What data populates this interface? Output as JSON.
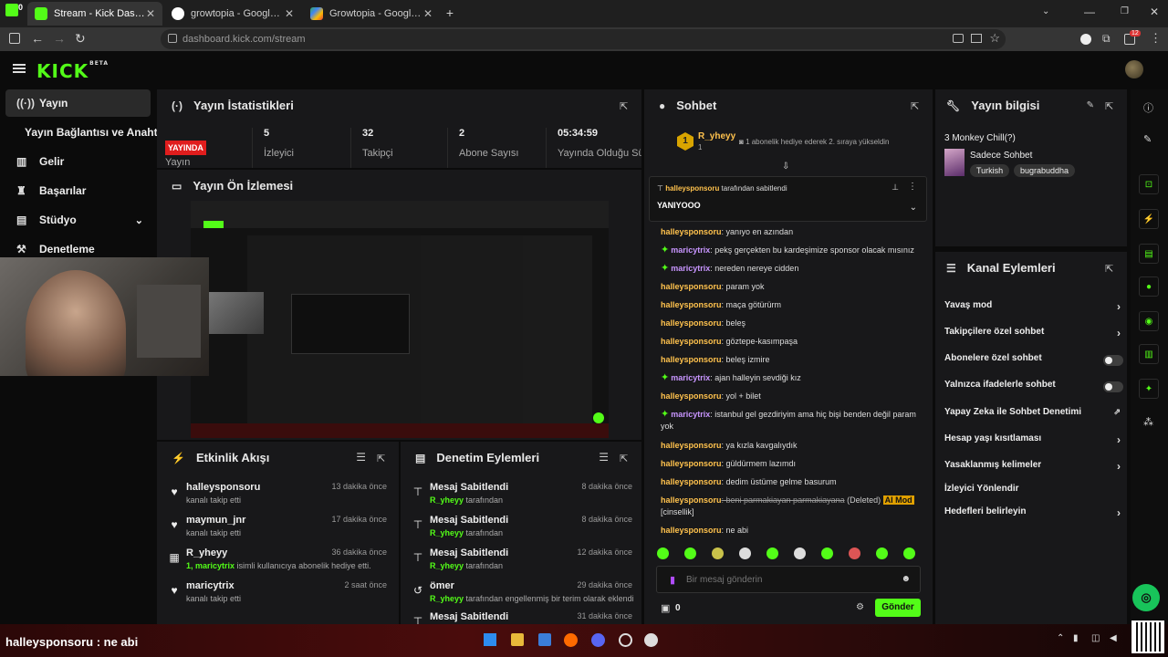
{
  "browser": {
    "tabs": [
      {
        "title": "Stream - Kick Dashboard",
        "fav": "#53fc18"
      },
      {
        "title": "growtopia - Google'da Ara",
        "fav": "#ffffff"
      },
      {
        "title": "Growtopia - Google Play'de Uygu",
        "fav": "#34a853"
      }
    ],
    "url_domain": "dashboard.kick.com",
    "url_path": "/stream",
    "notif_count": "12",
    "corner_badge": "0"
  },
  "header": {
    "logo": "KICK",
    "logo_sup": "BETA"
  },
  "nav": {
    "items": [
      {
        "label": "Yayın",
        "icon": "broadcast-icon"
      },
      {
        "label": "Yayın Bağlantısı ve Anahtarı",
        "icon": ""
      },
      {
        "label": "Gelir",
        "icon": "chart-icon"
      },
      {
        "label": "Başarılar",
        "icon": "trophy-icon"
      },
      {
        "label": "Stüdyo",
        "icon": "studio-icon"
      },
      {
        "label": "Denetleme",
        "icon": "gavel-icon"
      }
    ]
  },
  "stats": {
    "title": "Yayın İstatistikleri",
    "live_badge": "YAYINDA",
    "live_label": "Yayın",
    "items": [
      {
        "value": "5",
        "label": "İzleyici"
      },
      {
        "value": "32",
        "label": "Takipçi"
      },
      {
        "value": "2",
        "label": "Abone Sayısı"
      },
      {
        "value": "05:34:59",
        "label": "Yayında Olduğu Sü"
      }
    ]
  },
  "preview": {
    "title": "Yayın Ön İzlemesi"
  },
  "activity": {
    "title": "Etkinlik Akışı",
    "rows": [
      {
        "icon": "heart-icon",
        "user": "halleysponsoru",
        "sub": "kanalı takip etti",
        "time": "13 dakika önce"
      },
      {
        "icon": "heart-icon",
        "user": "maymun_jnr",
        "sub": "kanalı takip etti",
        "time": "17 dakika önce"
      },
      {
        "icon": "gift-icon",
        "user": "R_yheyy",
        "sub_pre": "1, ",
        "sub_user": "maricytrix",
        "sub": " isimli kullanıcıya abonelik hediye etti.",
        "time": "36 dakika önce"
      },
      {
        "icon": "heart-icon",
        "user": "maricytrix",
        "sub": "kanalı takip etti",
        "time": "2 saat önce"
      }
    ]
  },
  "modlog": {
    "title": "Denetim Eylemleri",
    "rows": [
      {
        "icon": "pin-icon",
        "title": "Mesaj Sabitlendi",
        "user": "R_yheyy",
        "sub": " tarafından",
        "time": "8 dakika önce"
      },
      {
        "icon": "pin-icon",
        "title": "Mesaj Sabitlendi",
        "user": "R_yheyy",
        "sub": " tarafından",
        "time": "8 dakika önce"
      },
      {
        "icon": "pin-icon",
        "title": "Mesaj Sabitlendi",
        "user": "R_yheyy",
        "sub": " tarafından",
        "time": "12 dakika önce"
      },
      {
        "icon": "undo-icon",
        "title": "ömer",
        "user": "R_yheyy",
        "sub": " tarafından engellenmiş bir terim olarak eklendi",
        "time": "29 dakika önce"
      },
      {
        "icon": "pin-icon",
        "title": "Mesaj Sabitlendi",
        "user": "",
        "sub": "",
        "time": "31 dakika önce"
      }
    ]
  },
  "chat": {
    "title": "Sohbet",
    "leader_rank": "1",
    "leader_name": "R_yheyy",
    "leader_count": "1",
    "leader_note": "1 abonelik hediye ederek 2. sıraya yükseldin",
    "pinned_by": "halleysponsoru",
    "pinned_suffix": " tarafından sabitlendi",
    "pinned_text": "YANIYOOO",
    "messages": [
      {
        "user": "halleysponsoru",
        "text": ": yanıyo en azından",
        "sub": false
      },
      {
        "user": "maricytrix",
        "text": ": pekş gerçekten bu kardeşimize sponsor olacak mısınız",
        "sub": true
      },
      {
        "user": "maricytrix",
        "text": ": nereden nereye cidden",
        "sub": true
      },
      {
        "user": "halleysponsoru",
        "text": ": param yok",
        "sub": false
      },
      {
        "user": "halleysponsoru",
        "text": ": maça götürürm",
        "sub": false
      },
      {
        "user": "halleysponsoru",
        "text": ": beleş",
        "sub": false
      },
      {
        "user": "halleysponsoru",
        "text": ": göztepe-kasımpaşa",
        "sub": false
      },
      {
        "user": "halleysponsoru",
        "text": ": beleş izmire",
        "sub": false
      },
      {
        "user": "maricytrix",
        "text": ": ajan halleyin sevdiği kız",
        "sub": true
      },
      {
        "user": "halleysponsoru",
        "text": ": yol + bilet",
        "sub": false
      },
      {
        "user": "maricytrix",
        "text": ": istanbul gel gezdiriyim ama hiç bişi benden değil param yok",
        "sub": true
      },
      {
        "user": "halleysponsoru",
        "text": ": ya kızla kavgalıydık",
        "sub": false
      },
      {
        "user": "halleysponsoru",
        "text": ": güldürmem lazımdı",
        "sub": false
      },
      {
        "user": "halleysponsoru",
        "text": ": dedim üstüme gelme basurum",
        "sub": false
      }
    ],
    "deleted": {
      "user": "halleysponsoru",
      "text": ": beni parmakiayan parmakiayana",
      "tag": "(Deleted)",
      "mod": "AI Mod",
      "reason": "[cinsellik]"
    },
    "last": {
      "user": "halleysponsoru",
      "text": ": ne abi"
    },
    "placeholder": "Bir mesaj gönderin",
    "points": "0",
    "send": "Gönder"
  },
  "streaminfo": {
    "title": "Yayın bilgisi",
    "stream_title": "3 Monkey Chill(?)",
    "category": "Sadece Sohbet",
    "tags": [
      "Turkish",
      "bugrabuddha"
    ]
  },
  "channel": {
    "title": "Kanal Eylemleri",
    "actions": [
      {
        "label": "Yavaş mod",
        "ctl": "chevron"
      },
      {
        "label": "Takipçilere özel sohbet",
        "ctl": "chevron"
      },
      {
        "label": "Abonelere özel sohbet",
        "ctl": "toggle"
      },
      {
        "label": "Yalnızca ifadelerle sohbet",
        "ctl": "toggle"
      },
      {
        "label": "Yapay Zeka ile Sohbet Denetimi",
        "ctl": "external"
      },
      {
        "label": "Hesap yaşı kısıtlaması",
        "ctl": "chevron"
      },
      {
        "label": "Yasaklanmış kelimeler",
        "ctl": "chevron"
      },
      {
        "label": "İzleyici Yönlendir",
        "ctl": "none"
      },
      {
        "label": "Hedefleri belirleyin",
        "ctl": "chevron"
      }
    ]
  },
  "overlay": {
    "ticker": "halleysponsoru : ne abi"
  },
  "colors": {
    "accent": "#53fc18",
    "live": "#e01d1d",
    "username": "#ffc24d",
    "sub_username": "#c895ff"
  }
}
